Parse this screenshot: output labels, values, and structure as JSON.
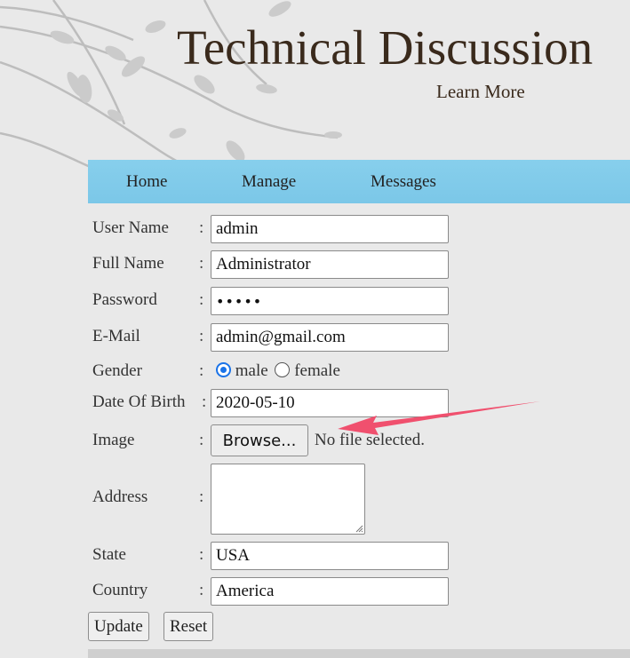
{
  "header": {
    "site_title": "Technical Discussion",
    "learn_more": "Learn More"
  },
  "nav": {
    "items": [
      {
        "label": "Home"
      },
      {
        "label": "Manage"
      },
      {
        "label": "Messages"
      }
    ]
  },
  "form": {
    "colon": ":",
    "user_name": {
      "label": "User Name",
      "value": "admin"
    },
    "full_name": {
      "label": "Full Name",
      "value": "Administrator"
    },
    "password": {
      "label": "Password",
      "value": "•••••"
    },
    "email": {
      "label": "E-Mail",
      "value": "admin@gmail.com"
    },
    "gender": {
      "label": "Gender",
      "options": [
        {
          "label": "male",
          "checked": true
        },
        {
          "label": "female",
          "checked": false
        }
      ]
    },
    "dob": {
      "label": "Date Of Birth",
      "value": "2020-05-10"
    },
    "image": {
      "label": "Image",
      "browse_label": "Browse...",
      "status": "No file selected."
    },
    "address": {
      "label": "Address",
      "value": ""
    },
    "state": {
      "label": "State",
      "value": "USA"
    },
    "country": {
      "label": "Country",
      "value": "America"
    },
    "buttons": {
      "update": "Update",
      "reset": "Reset"
    }
  },
  "colors": {
    "nav_bg": "#87cfec",
    "title": "#3a2a1c",
    "annotation_arrow": "#f0506e"
  },
  "annotation": {
    "icon": "arrow-icon"
  }
}
